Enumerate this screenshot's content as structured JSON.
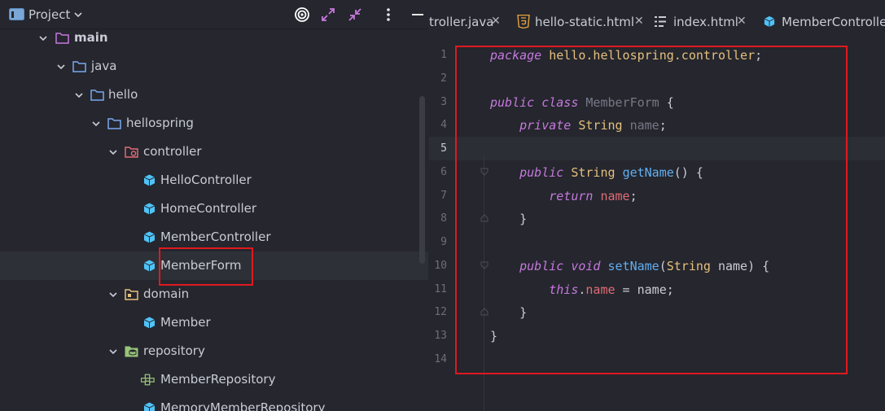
{
  "project_panel": {
    "title": "Project",
    "tree": [
      {
        "label": "main",
        "icon": "folder-icon",
        "expanded": true
      },
      {
        "label": "java",
        "icon": "folder-icon",
        "expanded": true
      },
      {
        "label": "hello",
        "icon": "folder-icon",
        "expanded": true
      },
      {
        "label": "hellospring",
        "icon": "folder-icon",
        "expanded": true
      },
      {
        "label": "controller",
        "icon": "controller-package-icon",
        "expanded": true
      },
      {
        "label": "HelloController",
        "icon": "class-icon"
      },
      {
        "label": "HomeController",
        "icon": "class-icon"
      },
      {
        "label": "MemberController",
        "icon": "class-icon"
      },
      {
        "label": "MemberForm",
        "icon": "class-icon",
        "selected": true
      },
      {
        "label": "domain",
        "icon": "domain-package-icon",
        "expanded": true
      },
      {
        "label": "Member",
        "icon": "class-icon"
      },
      {
        "label": "repository",
        "icon": "repository-package-icon",
        "expanded": true
      },
      {
        "label": "MemberRepository",
        "icon": "interface-icon"
      },
      {
        "label": "MemoryMemberRepository",
        "icon": "class-icon"
      }
    ]
  },
  "tabs": [
    {
      "label": "troller.java",
      "icon": "",
      "closable": true
    },
    {
      "label": "hello-static.html",
      "icon": "html5-icon",
      "closable": true
    },
    {
      "label": "index.html",
      "icon": "html-structure-icon",
      "closable": true
    },
    {
      "label": "MemberController.j",
      "icon": "class-icon",
      "closable": false
    }
  ],
  "editor": {
    "current_line": 5,
    "lines": [
      {
        "n": "1",
        "tokens": [
          [
            "kw",
            "package"
          ],
          [
            "txt",
            " "
          ],
          [
            "pkg",
            "hello.hellospring.controller"
          ],
          [
            "txt",
            ";"
          ]
        ]
      },
      {
        "n": "2",
        "tokens": []
      },
      {
        "n": "3",
        "tokens": [
          [
            "kw",
            "public"
          ],
          [
            "txt",
            " "
          ],
          [
            "kw",
            "class"
          ],
          [
            "txt",
            " "
          ],
          [
            "dim",
            "MemberForm"
          ],
          [
            "txt",
            " {"
          ]
        ]
      },
      {
        "n": "4",
        "tokens": [
          [
            "txt",
            "    "
          ],
          [
            "kw",
            "private"
          ],
          [
            "txt",
            " "
          ],
          [
            "cls",
            "String"
          ],
          [
            "txt",
            " "
          ],
          [
            "dim",
            "name"
          ],
          [
            "txt",
            ";"
          ]
        ]
      },
      {
        "n": "5",
        "tokens": []
      },
      {
        "n": "6",
        "tokens": [
          [
            "txt",
            "    "
          ],
          [
            "kw",
            "public"
          ],
          [
            "txt",
            " "
          ],
          [
            "cls",
            "String"
          ],
          [
            "txt",
            " "
          ],
          [
            "fn",
            "getName"
          ],
          [
            "txt",
            "() {"
          ]
        ]
      },
      {
        "n": "7",
        "tokens": [
          [
            "txt",
            "        "
          ],
          [
            "kw",
            "return"
          ],
          [
            "txt",
            " "
          ],
          [
            "fld",
            "name"
          ],
          [
            "txt",
            ";"
          ]
        ]
      },
      {
        "n": "8",
        "tokens": [
          [
            "txt",
            "    }"
          ]
        ]
      },
      {
        "n": "9",
        "tokens": []
      },
      {
        "n": "10",
        "tokens": [
          [
            "txt",
            "    "
          ],
          [
            "kw",
            "public"
          ],
          [
            "txt",
            " "
          ],
          [
            "kw",
            "void"
          ],
          [
            "txt",
            " "
          ],
          [
            "fn",
            "setName"
          ],
          [
            "txt",
            "("
          ],
          [
            "cls",
            "String"
          ],
          [
            "txt",
            " name) {"
          ]
        ]
      },
      {
        "n": "11",
        "tokens": [
          [
            "txt",
            "        "
          ],
          [
            "kw",
            "this"
          ],
          [
            "txt",
            "."
          ],
          [
            "fld",
            "name"
          ],
          [
            "txt",
            " = name;"
          ]
        ]
      },
      {
        "n": "12",
        "tokens": [
          [
            "txt",
            "    }"
          ]
        ]
      },
      {
        "n": "13",
        "tokens": [
          [
            "txt",
            "}"
          ]
        ]
      },
      {
        "n": "14",
        "tokens": []
      }
    ]
  },
  "colors": {
    "background": "#25262e",
    "keyword": "#c679dd",
    "type": "#e5c07b",
    "method": "#61afef",
    "field": "#e06c75",
    "annotation_box": "#e0191f"
  }
}
